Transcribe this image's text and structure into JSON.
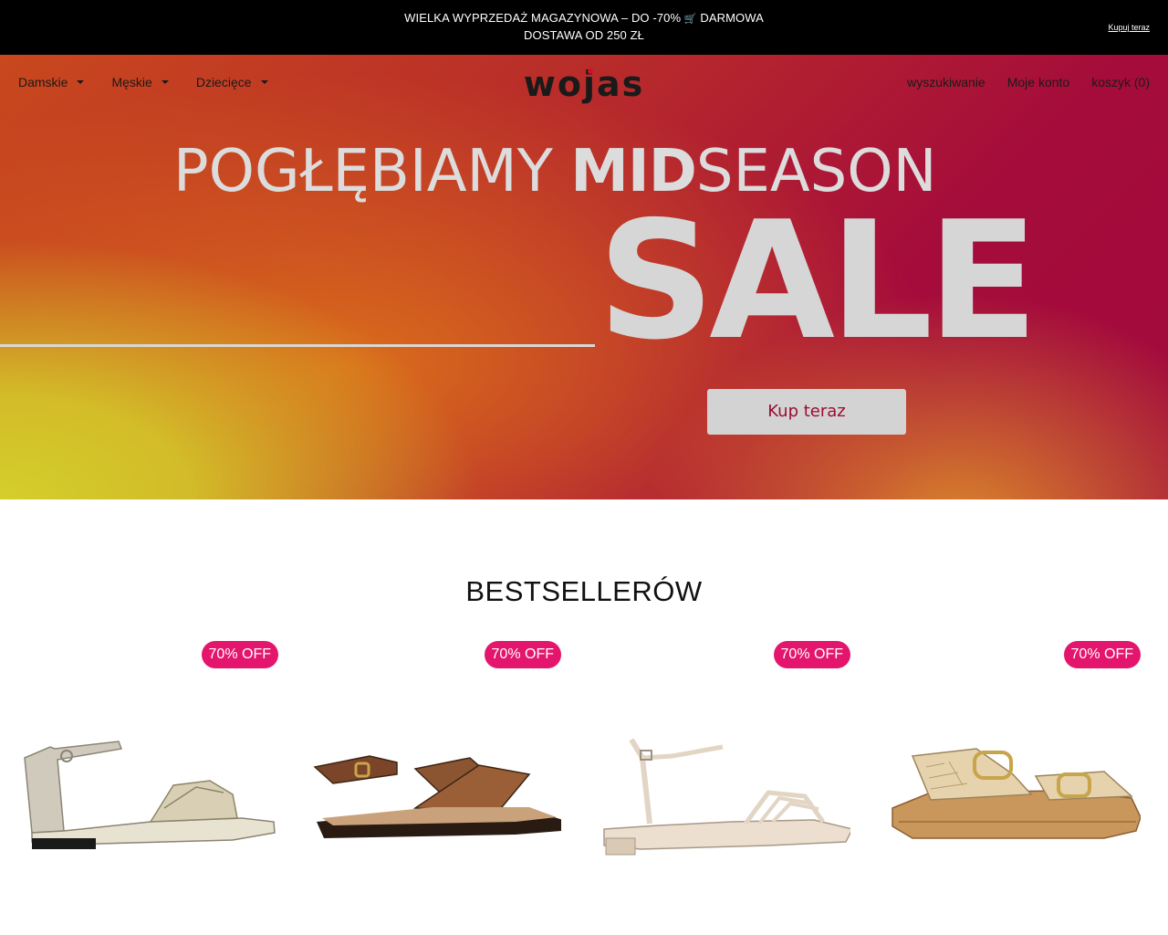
{
  "announcement": {
    "line1_a": "WIELKA WYPRZEDAŻ MAGAZYNOWA – DO -70%",
    "cart_icon": "🛒",
    "line1_b": "DARMOWA",
    "line2": "DOSTAWA OD 250 ZŁ",
    "buy_link": "Kupuj teraz"
  },
  "nav": {
    "left": [
      {
        "label": "Damskie"
      },
      {
        "label": "Męskie"
      },
      {
        "label": "Dziecięce"
      }
    ],
    "logo_text": "wojas",
    "right": {
      "search": "wyszukiwanie",
      "account": "Moje konto",
      "cart": "koszyk (0)"
    }
  },
  "hero": {
    "headline_light": "POGŁĘBIAMY",
    "headline_bold": "MID",
    "headline_light2": "SEASON",
    "big": "SALE",
    "cta": "Kup teraz",
    "colors": {
      "cta_text": "#9b0c34",
      "text": "#dcdcdc"
    }
  },
  "bestsellers": {
    "title": "BESTSELLERÓW",
    "products": [
      {
        "badge": "70% OFF",
        "icon": "silver-sandal-icon"
      },
      {
        "badge": "70% OFF",
        "icon": "brown-cross-strap-sandal-icon"
      },
      {
        "badge": "70% OFF",
        "icon": "cream-strappy-sandal-icon"
      },
      {
        "badge": "70% OFF",
        "icon": "woven-buckle-sandal-icon"
      }
    ],
    "badge_color": "#e4156c"
  }
}
